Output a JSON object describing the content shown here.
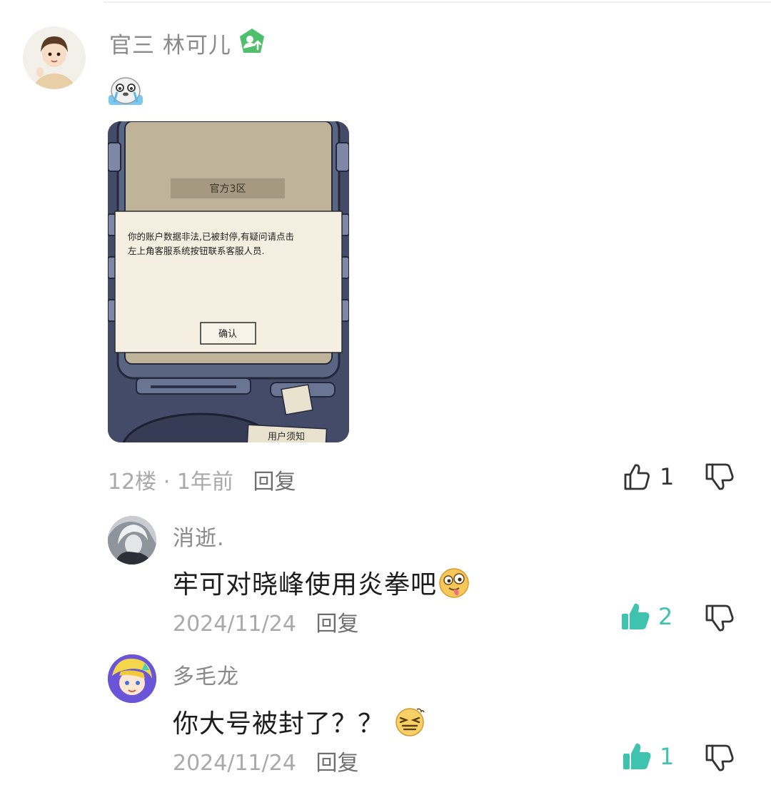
{
  "main_comment": {
    "username": "官三 林可儿",
    "badge_icon": "green-pentagon-user-up-icon",
    "sticker_icon": "crying-seal-emoji",
    "image": {
      "server_label": "官方3区",
      "dialog_line1": "你的账户数据非法,已被封停,有疑问请点击",
      "dialog_line2": "左上角客服系统按钮联系客服人员.",
      "confirm_label": "确认",
      "card_text": "用户须知"
    },
    "floor": "12楼",
    "separator": "·",
    "time": "1年前",
    "reply_label": "回复",
    "like_count": "1",
    "liked": false
  },
  "replies": [
    {
      "username": "消逝.",
      "text": "牢可对晓峰使用炎拳吧",
      "emoji_icon": "dizzy-face-tongue-emoji",
      "date": "2024/11/24",
      "reply_label": "回复",
      "like_count": "2",
      "liked": true
    },
    {
      "username": "多毛龙",
      "text": "你大号被封了？？",
      "emoji_icon": "squinting-laugh-emoji",
      "date": "2024/11/24",
      "reply_label": "回复",
      "like_count": "1",
      "liked": true
    }
  ],
  "colors": {
    "accent_teal": "#3fc2ae",
    "badge_green": "#4fbf6b",
    "meta_grey": "#a9a9a9"
  }
}
